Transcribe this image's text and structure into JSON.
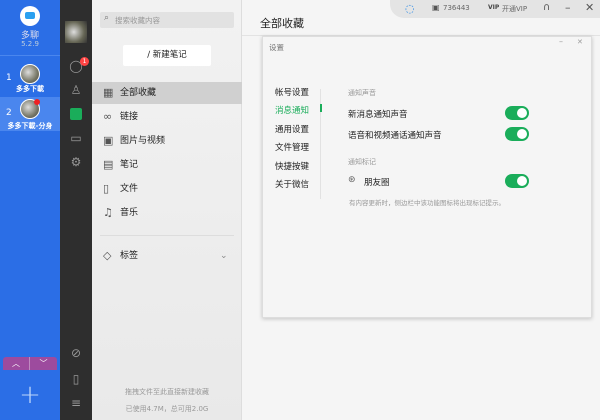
{
  "app": {
    "name": "多聊",
    "version": "5.2.9"
  },
  "accounts": [
    {
      "index": "1",
      "name": "多多下載"
    },
    {
      "index": "2",
      "name": "多多下載-分身",
      "has_badge": true
    }
  ],
  "nav": {
    "chat_badge": "1",
    "accent": "#1aad5a"
  },
  "middle": {
    "search_placeholder": "搜索收藏内容",
    "new_note": "新建笔记",
    "items": [
      {
        "label": "全部收藏",
        "icon": "grid-icon"
      },
      {
        "label": "链接",
        "icon": "link-icon"
      },
      {
        "label": "图片与视频",
        "icon": "image-icon"
      },
      {
        "label": "笔记",
        "icon": "note-icon"
      },
      {
        "label": "文件",
        "icon": "file-icon"
      },
      {
        "label": "音乐",
        "icon": "music-icon"
      }
    ],
    "tags": "标签",
    "footer_line1": "拖拽文件至此直接新建收藏",
    "footer_line2": "已使用4.7M，总可用2.0G"
  },
  "topbar": {
    "id": "736443",
    "vip": "开通VIP"
  },
  "main": {
    "title": "全部收藏"
  },
  "settings": {
    "title": "设置",
    "nav": [
      "帐号设置",
      "消息通知",
      "通用设置",
      "文件管理",
      "快捷按键",
      "关于微信"
    ],
    "active": "消息通知",
    "section1": "通知声音",
    "opt1": "新消息通知声音",
    "opt1_on": true,
    "opt2": "语音和视频通话通知声音",
    "opt2_on": true,
    "section2": "通知标记",
    "opt3": "朋友圈",
    "opt3_on": true,
    "hint": "有内容更新时，侧边栏中该功能图标将出现标记提示。"
  }
}
